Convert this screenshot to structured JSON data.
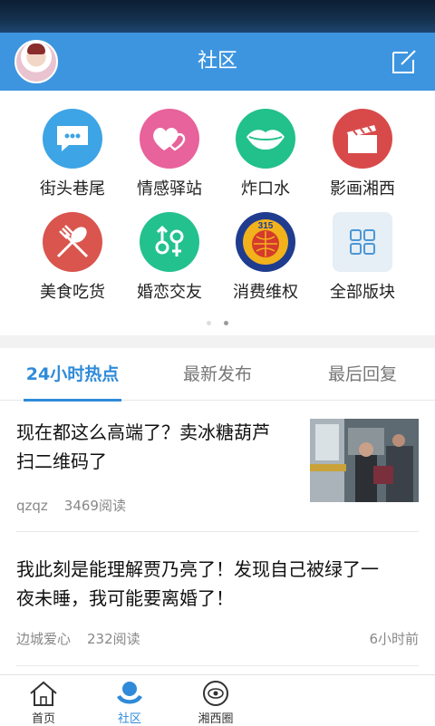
{
  "header": {
    "title": "社区"
  },
  "categories": [
    {
      "label": "街头巷尾",
      "icon": "chat-bubble-icon",
      "color": "#3da4e5"
    },
    {
      "label": "情感驿站",
      "icon": "hearts-icon",
      "color": "#e8629b"
    },
    {
      "label": "炸口水",
      "icon": "lips-icon",
      "color": "#22c08a"
    },
    {
      "label": "影画湘西",
      "icon": "clapperboard-icon",
      "color": "#d84a4a"
    },
    {
      "label": "美食吃货",
      "icon": "fork-spoon-icon",
      "color": "#d9554d"
    },
    {
      "label": "婚恋交友",
      "icon": "gender-icon",
      "color": "#23c18e"
    },
    {
      "label": "消费维权",
      "icon": "consumer-rights-315-icon",
      "color": "#1f3c8f",
      "badge_text": "315"
    },
    {
      "label": "全部版块",
      "icon": "grid-icon",
      "color": "#4b98d4"
    }
  ],
  "tabs": [
    {
      "label": "24小时热点"
    },
    {
      "label": "最新发布"
    },
    {
      "label": "最后回复"
    }
  ],
  "posts": [
    {
      "title_line1": "现在都这么高端了？卖冰糖葫芦",
      "title_line2": "扫二维码了",
      "author": "qzqz",
      "reads": "3469阅读",
      "time": ""
    },
    {
      "title_line1": "我此刻是能理解贾乃亮了！发现自己被绿了一",
      "title_line2": "夜未睡，我可能要离婚了！",
      "author": "边城爱心",
      "reads": "232阅读",
      "time": "6小时前"
    }
  ],
  "bottom_nav": [
    {
      "label": "首页",
      "icon": "home-icon"
    },
    {
      "label": "社区",
      "icon": "community-icon"
    },
    {
      "label": "湘西圈",
      "icon": "circle-eye-icon"
    }
  ],
  "colors": {
    "brand": "#3d95e0",
    "accent": "#2f8bd9"
  }
}
